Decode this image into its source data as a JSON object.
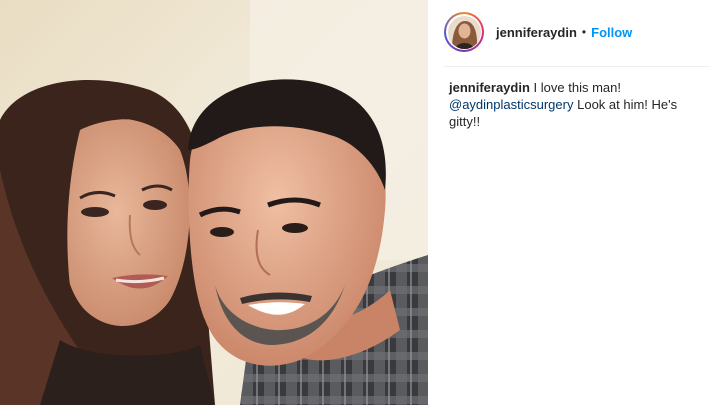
{
  "header": {
    "username": "jenniferaydin",
    "separator": "•",
    "follow_label": "Follow"
  },
  "caption": {
    "author": "jenniferaydin",
    "text_before": "I love this man!",
    "mention": "@aydinplasticsurgery",
    "text_after": "Look at him! He's gitty!!"
  },
  "icons": {
    "avatar": "profile-avatar-icon"
  },
  "colors": {
    "follow": "#0095f6",
    "mention": "#00376b",
    "text": "#262626",
    "avatar_ring": [
      "#f58529",
      "#dd2a7b",
      "#8134af",
      "#515bd4"
    ]
  }
}
